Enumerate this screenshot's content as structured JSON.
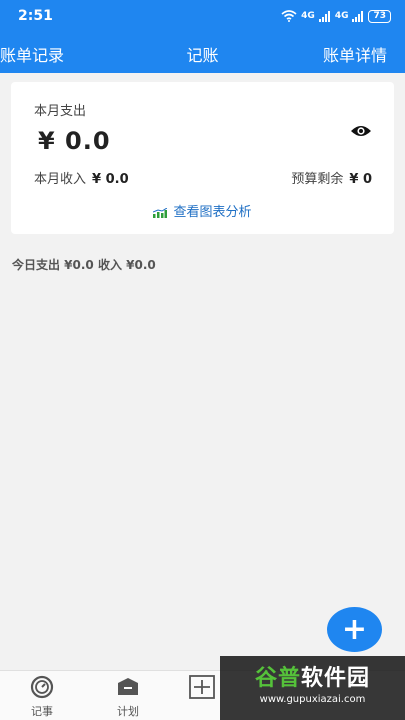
{
  "status": {
    "time": "2:51",
    "battery": "73",
    "signal1": "4G",
    "signal2": "4G"
  },
  "appbar": {
    "left": "账单记录",
    "title": "记账",
    "right": "账单详情"
  },
  "summary": {
    "month_expense_label": "本月支出",
    "month_expense_value": "¥ 0.0",
    "month_income_label": "本月收入",
    "month_income_value": "¥ 0.0",
    "budget_label": "预算剩余",
    "budget_value": "¥ 0",
    "chart_link": "查看图表分析"
  },
  "today": {
    "text": "今日支出 ¥0.0 收入 ¥0.0"
  },
  "fab": {
    "label": "+"
  },
  "nav": {
    "items": [
      {
        "label": "记事"
      },
      {
        "label": "计划"
      }
    ]
  },
  "watermark": {
    "title_green": "谷普",
    "title_white": "软件园",
    "url": "www.gupuxiazai.com"
  }
}
